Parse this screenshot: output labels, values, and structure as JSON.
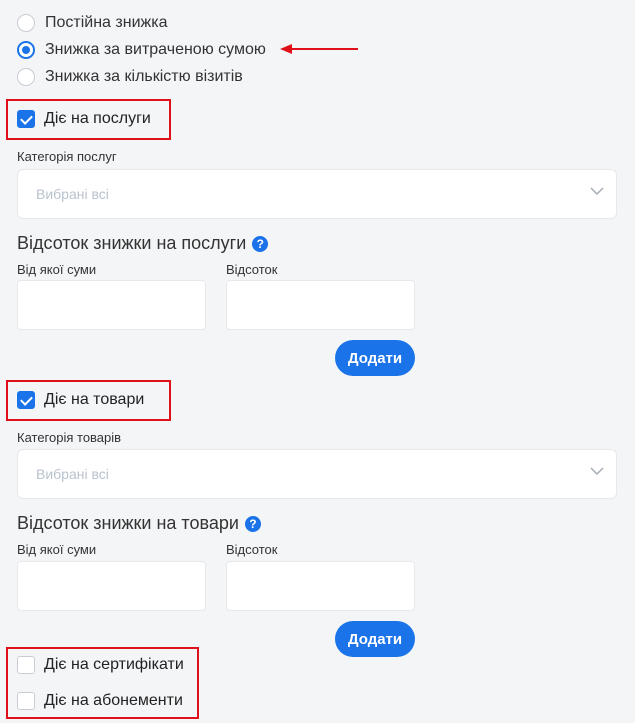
{
  "discount_types": [
    {
      "label": "Постійна знижка",
      "selected": false
    },
    {
      "label": "Знижка за витраченою сумою",
      "selected": true
    },
    {
      "label": "Знижка за кількістю візитів",
      "selected": false
    }
  ],
  "services": {
    "checkbox_label": "Діє на послуги",
    "checked": true,
    "category_label": "Категорія послуг",
    "category_value": "Вибрані всі",
    "percent_title": "Відсоток знижки на послуги",
    "help_icon": "?",
    "from_sum_label": "Від якої суми",
    "percent_label": "Відсоток",
    "add_button": "Додати"
  },
  "goods": {
    "checkbox_label": "Діє на товари",
    "checked": true,
    "category_label": "Категорія товарів",
    "category_value": "Вибрані всі",
    "percent_title": "Відсоток знижки на товари",
    "help_icon": "?",
    "from_sum_label": "Від якої суми",
    "percent_label": "Відсоток",
    "add_button": "Додати"
  },
  "certificates": {
    "checkbox_label": "Діє на сертифікати",
    "checked": false
  },
  "subscriptions": {
    "checkbox_label": "Діє на абонементи",
    "checked": false
  },
  "colors": {
    "accent": "#1a73e8",
    "highlight": "#e0101b"
  }
}
